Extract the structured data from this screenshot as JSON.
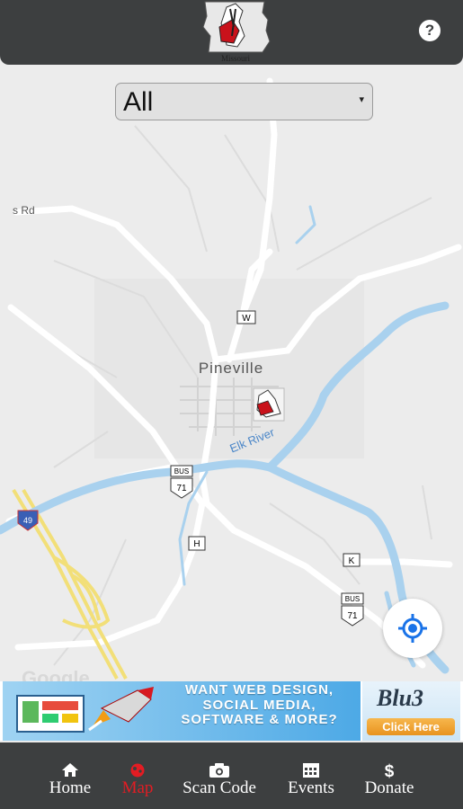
{
  "header": {
    "logo_text": "Missouri",
    "help_label": "?"
  },
  "filter": {
    "selected": "All",
    "arrow": "▾"
  },
  "map": {
    "town": "Pineville",
    "river": "Elk River",
    "road_partial": "s Rd",
    "shield_w": "W",
    "shield_h": "H",
    "shield_k": "K",
    "bus_label": "BUS",
    "us_route": "71",
    "interstate": "49",
    "watermark": "Google"
  },
  "ad": {
    "line1": "WANT WEB DESIGN,",
    "line2": "SOCIAL MEDIA,",
    "line3": "SOFTWARE & MORE?",
    "brand": "Blu3",
    "cta": "Click Here"
  },
  "nav": {
    "items": [
      {
        "label": "Home",
        "icon": "home-icon",
        "active": false
      },
      {
        "label": "Map",
        "icon": "map-pin-icon",
        "active": true
      },
      {
        "label": "Scan Code",
        "icon": "camera-icon",
        "active": false
      },
      {
        "label": "Events",
        "icon": "calendar-icon",
        "active": false
      },
      {
        "label": "Donate",
        "icon": "dollar-icon",
        "active": false
      }
    ]
  },
  "colors": {
    "header_bg": "#3d3f40",
    "active_nav": "#e31c23",
    "river": "#a9d1ee",
    "locate": "#1a73e8"
  }
}
